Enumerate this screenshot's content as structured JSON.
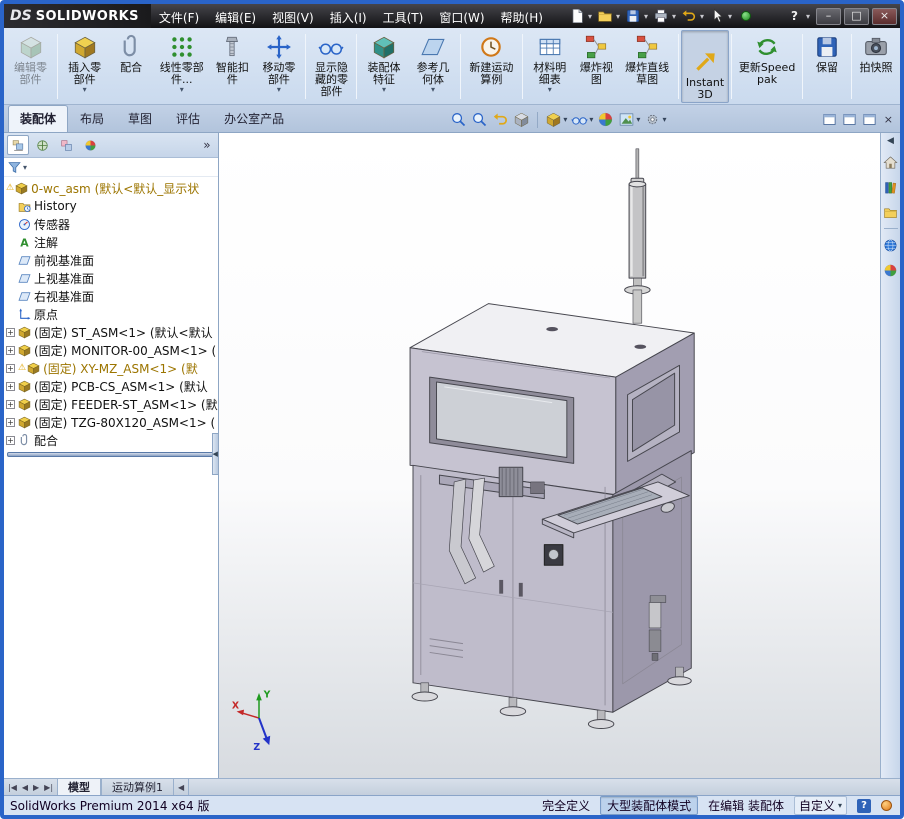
{
  "colors": {
    "frame": "#2a64c8",
    "titlebar_bg": "#1a1a1e",
    "ribbon_bg": "#dce7f5",
    "tabrow_bg": "#c2d1e6",
    "panel_header_bg": "#d9e4f2",
    "status_bg": "#d7e3f3",
    "warn_text": "#9c7500",
    "accent": "#2a64c8",
    "viewport_top": "#ffffff",
    "viewport_bottom": "#d7dbe0"
  },
  "icons": {
    "expand": "+",
    "chevron-down": "▾",
    "overflow": "»",
    "warning": "⚠",
    "minimize": "–",
    "maximize": "□",
    "close": "×",
    "help": "?",
    "collapse-left": "◀"
  },
  "titlebar": {
    "logo_ds": "DS",
    "logo_text": "SOLIDWORKS",
    "menus": [
      "文件(F)",
      "编辑(E)",
      "视图(V)",
      "插入(I)",
      "工具(T)",
      "窗口(W)",
      "帮助(H)"
    ]
  },
  "ribbon": {
    "buttons": [
      {
        "label": "编辑零部件",
        "state": "disabled"
      },
      {
        "label": "插入零部件",
        "caret": true
      },
      {
        "label": "配合"
      },
      {
        "label": "线性零部件...",
        "caret": true
      },
      {
        "label": "智能扣件"
      },
      {
        "label": "移动零部件",
        "caret": true
      },
      {
        "label": "显示隐藏的零部件"
      },
      {
        "label": "装配体特征",
        "caret": true
      },
      {
        "label": "参考几何体",
        "caret": true
      },
      {
        "label": "新建运动算例"
      },
      {
        "label": "材料明细表",
        "caret": true
      },
      {
        "label": "爆炸视图"
      },
      {
        "label": "爆炸直线草图"
      },
      {
        "label": "Instant3D",
        "state": "active"
      },
      {
        "label": "更新Speedpak"
      },
      {
        "label": "保留"
      },
      {
        "label": "拍快照"
      }
    ]
  },
  "command_tabs": {
    "items": [
      "装配体",
      "布局",
      "草图",
      "评估",
      "办公室产品"
    ],
    "active": "装配体"
  },
  "feature_panel": {
    "tree": [
      {
        "label": "0-wc_asm (默认<默认_显示状",
        "kind": "assembly-root",
        "warning": true,
        "highlight": true
      },
      {
        "label": "History",
        "kind": "history-folder"
      },
      {
        "label": "传感器",
        "kind": "sensors"
      },
      {
        "label": "注解",
        "kind": "annotations"
      },
      {
        "label": "前视基准面",
        "kind": "plane"
      },
      {
        "label": "上视基准面",
        "kind": "plane"
      },
      {
        "label": "右视基准面",
        "kind": "plane"
      },
      {
        "label": "原点",
        "kind": "origin"
      },
      {
        "label": "(固定) ST_ASM<1> (默认<默认",
        "kind": "component",
        "expandable": true
      },
      {
        "label": "(固定) MONITOR-00_ASM<1> (",
        "kind": "component",
        "expandable": true
      },
      {
        "label": "(固定) XY-MZ_ASM<1> (默",
        "kind": "component",
        "expandable": true,
        "warning": true,
        "highlight": true
      },
      {
        "label": "(固定) PCB-CS_ASM<1> (默认",
        "kind": "component",
        "expandable": true
      },
      {
        "label": "(固定) FEEDER-ST_ASM<1> (默",
        "kind": "component",
        "expandable": true
      },
      {
        "label": "(固定) TZG-80X120_ASM<1> (",
        "kind": "component",
        "expandable": true
      },
      {
        "label": "配合",
        "kind": "mates",
        "expandable": true
      }
    ]
  },
  "viewport": {
    "triad": {
      "x": "X",
      "y": "Y",
      "z": "Z"
    }
  },
  "dock_tabs": {
    "nav": [
      "|◀",
      "◀",
      "▶",
      "▶|"
    ],
    "items": [
      "模型",
      "运动算例1"
    ],
    "active": "模型"
  },
  "statusbar": {
    "app": "SolidWorks Premium 2014 x64 版",
    "defined": "完全定义",
    "mode": "大型装配体模式",
    "editing": "在编辑 装配体",
    "custom": "自定义"
  }
}
